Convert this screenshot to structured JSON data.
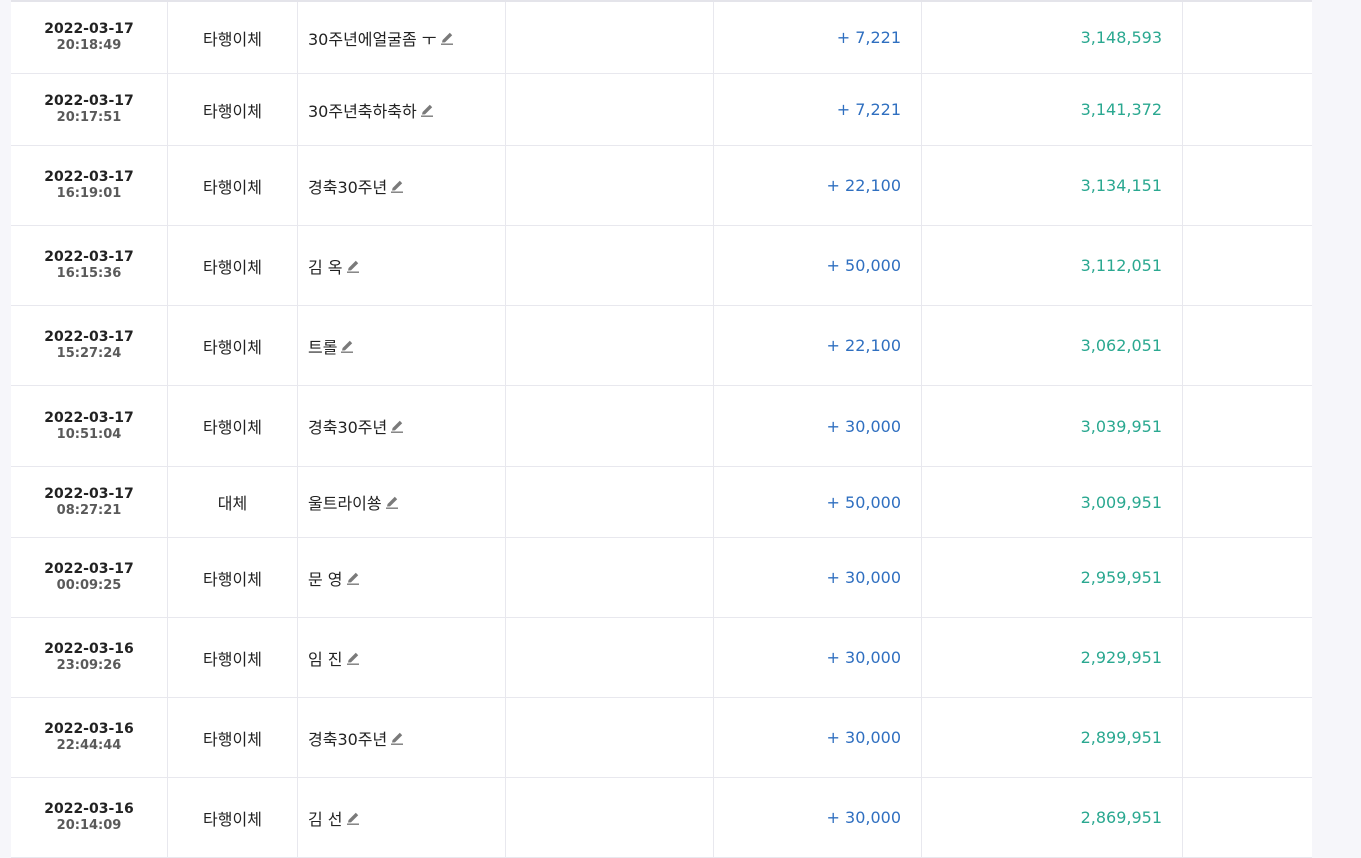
{
  "transactions": [
    {
      "date": "2022-03-17",
      "time": "20:18:49",
      "type": "타행이체",
      "memo": "30주년에얼굴좀 ㅜ",
      "amount": "+ 7,221",
      "balance": "3,148,593"
    },
    {
      "date": "2022-03-17",
      "time": "20:17:51",
      "type": "타행이체",
      "memo": "30주년축하축하",
      "amount": "+ 7,221",
      "balance": "3,141,372"
    },
    {
      "date": "2022-03-17",
      "time": "16:19:01",
      "type": "타행이체",
      "memo": "경축30주년",
      "amount": "+ 22,100",
      "balance": "3,134,151"
    },
    {
      "date": "2022-03-17",
      "time": "16:15:36",
      "type": "타행이체",
      "memo": "김   옥",
      "amount": "+ 50,000",
      "balance": "3,112,051"
    },
    {
      "date": "2022-03-17",
      "time": "15:27:24",
      "type": "타행이체",
      "memo": "트롤",
      "amount": "+ 22,100",
      "balance": "3,062,051"
    },
    {
      "date": "2022-03-17",
      "time": "10:51:04",
      "type": "타행이체",
      "memo": "경축30주년",
      "amount": "+ 30,000",
      "balance": "3,039,951"
    },
    {
      "date": "2022-03-17",
      "time": "08:27:21",
      "type": "대체",
      "memo": "울트라이쑝",
      "amount": "+ 50,000",
      "balance": "3,009,951"
    },
    {
      "date": "2022-03-17",
      "time": "00:09:25",
      "type": "타행이체",
      "memo": "문   영",
      "amount": "+ 30,000",
      "balance": "2,959,951"
    },
    {
      "date": "2022-03-16",
      "time": "23:09:26",
      "type": "타행이체",
      "memo": "임   진",
      "amount": "+ 30,000",
      "balance": "2,929,951"
    },
    {
      "date": "2022-03-16",
      "time": "22:44:44",
      "type": "타행이체",
      "memo": "경축30주년",
      "amount": "+ 30,000",
      "balance": "2,899,951"
    },
    {
      "date": "2022-03-16",
      "time": "20:14:09",
      "type": "타행이체",
      "memo": "김   선",
      "amount": "+ 30,000",
      "balance": "2,869,951"
    }
  ],
  "colors": {
    "amount": "#2f6fc0",
    "balance": "#2aa890",
    "border": "#e8e8ee"
  },
  "icons": {
    "memo_edit": "pencil-icon"
  }
}
